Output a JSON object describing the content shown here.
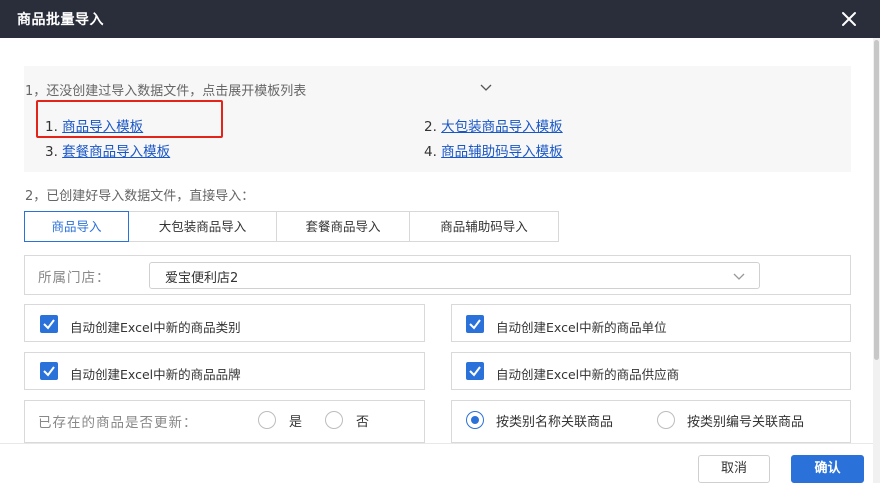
{
  "dialog": {
    "title": "商品批量导入"
  },
  "step1": {
    "text": "1，还没创建过导入数据文件，点击展开模板列表",
    "templates": [
      {
        "num": "1. ",
        "label": "商品导入模板"
      },
      {
        "num": "2. ",
        "label": "大包装商品导入模板"
      },
      {
        "num": "3. ",
        "label": "套餐商品导入模板"
      },
      {
        "num": "4. ",
        "label": "商品辅助码导入模板"
      }
    ]
  },
  "step2": {
    "text": "2，已创建好导入数据文件，直接导入："
  },
  "tabs": [
    {
      "label": "商品导入",
      "active": true
    },
    {
      "label": "大包装商品导入",
      "active": false
    },
    {
      "label": "套餐商品导入",
      "active": false
    },
    {
      "label": "商品辅助码导入",
      "active": false
    }
  ],
  "store": {
    "label": "所属门店：",
    "value": "爱宝便利店2"
  },
  "options": [
    {
      "label": "自动创建Excel中新的商品类别",
      "checked": true
    },
    {
      "label": "自动创建Excel中新的商品单位",
      "checked": true
    },
    {
      "label": "自动创建Excel中新的商品品牌",
      "checked": true
    },
    {
      "label": "自动创建Excel中新的商品供应商",
      "checked": true
    }
  ],
  "update": {
    "label": "已存在的商品是否更新：",
    "yes": "是",
    "no": "否",
    "selected": "none"
  },
  "match": {
    "by_name": "按类别名称关联商品",
    "by_code": "按类别编号关联商品",
    "selected": "by_name"
  },
  "footer": {
    "cancel": "取消",
    "confirm": "确认"
  },
  "colors": {
    "accent": "#2a72d9",
    "link": "#1a57c6",
    "highlight": "#e3241b",
    "titlebar": "#2a2d3a"
  }
}
